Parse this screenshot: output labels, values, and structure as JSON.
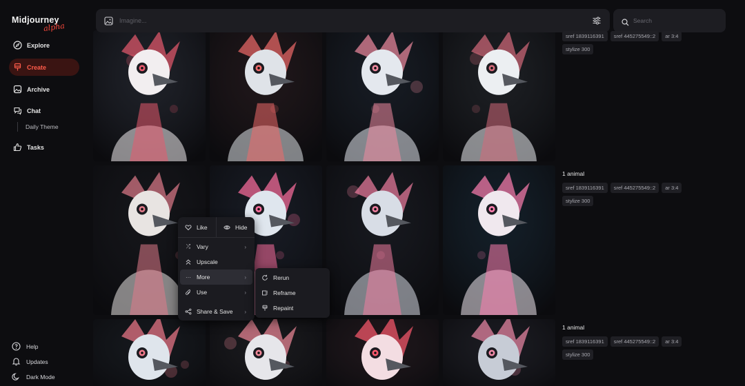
{
  "app": {
    "logo_text": "Midjourney",
    "logo_badge": "alpha"
  },
  "sidebar": {
    "items": [
      {
        "label": "Explore",
        "icon": "compass-icon"
      },
      {
        "label": "Create",
        "icon": "brush-icon",
        "active": true
      },
      {
        "label": "Archive",
        "icon": "image-icon"
      },
      {
        "label": "Chat",
        "icon": "chat-icon"
      },
      {
        "label": "Tasks",
        "icon": "thumbs-up-icon"
      }
    ],
    "chat_sub": "Daily Theme",
    "bottom": [
      {
        "label": "Help",
        "icon": "help-icon"
      },
      {
        "label": "Updates",
        "icon": "bell-icon"
      },
      {
        "label": "Dark Mode",
        "icon": "moon-icon"
      }
    ]
  },
  "topbar": {
    "imagine_placeholder": "Imagine...",
    "search_placeholder": "Search"
  },
  "rows": [
    {
      "title": "",
      "chips": [
        "sref 1839116391",
        "sref 445275549::2",
        "ar 3:4",
        "stylize 300"
      ]
    },
    {
      "title": "1 animal",
      "chips": [
        "sref 1839116391",
        "sref 445275549::2",
        "ar 3:4",
        "stylize 300"
      ]
    },
    {
      "title": "1 animal",
      "chips": [
        "sref 1839116391",
        "sref 445275549::2",
        "ar 3:4",
        "stylize 300"
      ]
    }
  ],
  "context_menu": {
    "like": "Like",
    "hide": "Hide",
    "items": [
      "Vary",
      "Upscale",
      "More",
      "Use",
      "Share & Save"
    ],
    "submenu": [
      "Rerun",
      "Reframe",
      "Repaint"
    ]
  },
  "colors": {
    "accent": "#ff4a3d",
    "background": "#0d0d10",
    "panel": "#1d1d22"
  }
}
